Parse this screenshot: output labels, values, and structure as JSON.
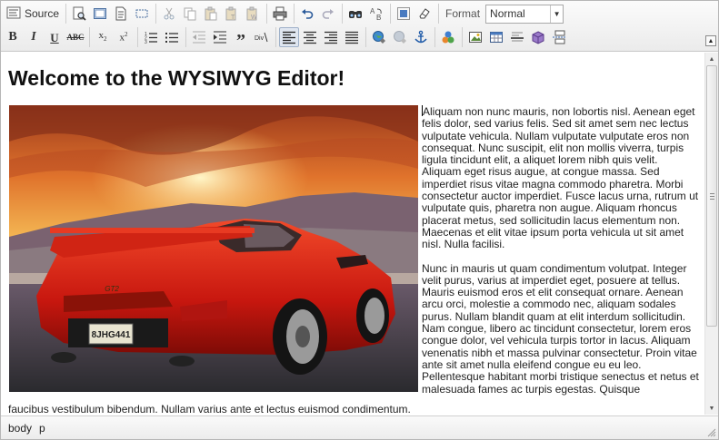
{
  "toolbar": {
    "source_label": "Source",
    "format_label": "Format",
    "format_value": "Normal"
  },
  "content": {
    "heading": "Welcome to the WYSIWYG Editor!",
    "paragraph1": "Aliquam non nunc mauris, non lobortis nisl. Aenean eget felis dolor, sed varius felis. Sed sit amet sem nec lectus vulputate vehicula. Nullam vulputate vulputate eros non consequat. Nunc suscipit, elit non mollis viverra, turpis ligula tincidunt elit, a aliquet lorem nibh quis velit. Aliquam eget risus augue, at congue massa. Sed imperdiet risus vitae magna commodo pharetra. Morbi consectetur auctor imperdiet. Fusce lacus urna, rutrum ut vulputate quis, pharetra non augue. Aliquam rhoncus placerat metus, sed sollicitudin lacus elementum non. Maecenas et elit vitae ipsum porta vehicula ut sit amet nisl. Nulla facilisi.",
    "paragraph2": "Nunc in mauris ut quam condimentum volutpat. Integer velit purus, varius at imperdiet eget, posuere at tellus. Mauris euismod eros et elit consequat ornare. Aenean arcu orci, molestie a commodo nec, aliquam sodales purus. Nullam blandit quam at elit interdum sollicitudin. Nam congue, libero ac tincidunt consectetur, lorem eros congue dolor, vel vehicula turpis tortor in lacus. Aliquam venenatis nibh et massa pulvinar consectetur. Proin vitae ante sit amet nulla eleifend congue eu eu leo. Pellentesque habitant morbi tristique senectus et netus et malesuada fames ac turpis egestas. Quisque",
    "continuation": "faucibus vestibulum bibendum. Nullam varius ante et lectus euismod condimentum.",
    "plate_text": "8JHG441",
    "badge_text": "GT2"
  },
  "statusbar": {
    "crumbs": [
      "body",
      "p"
    ]
  },
  "colors": {
    "toolbar_bg": "#efefef",
    "active_button": "#dfe6f0",
    "car": "#d6261b",
    "sky": "#f2a13a"
  },
  "icons": [
    "source-icon",
    "preview-icon",
    "templates-icon",
    "new-page-icon",
    "show-blocks-icon",
    "cut-icon",
    "copy-icon",
    "paste-icon",
    "paste-text-icon",
    "paste-word-icon",
    "print-icon",
    "undo-icon",
    "redo-icon",
    "find-icon",
    "replace-icon",
    "select-all-icon",
    "remove-format-icon",
    "bold-icon",
    "italic-icon",
    "underline-icon",
    "strikethrough-icon",
    "subscript-icon",
    "superscript-icon",
    "numbered-list-icon",
    "bulleted-list-icon",
    "outdent-icon",
    "indent-icon",
    "blockquote-icon",
    "create-div-icon",
    "align-left-icon",
    "align-center-icon",
    "align-right-icon",
    "justify-icon",
    "link-icon",
    "unlink-icon",
    "anchor-icon",
    "flash-icon",
    "image-icon",
    "table-icon",
    "horizontal-rule-icon",
    "special-char-icon",
    "page-break-icon"
  ]
}
